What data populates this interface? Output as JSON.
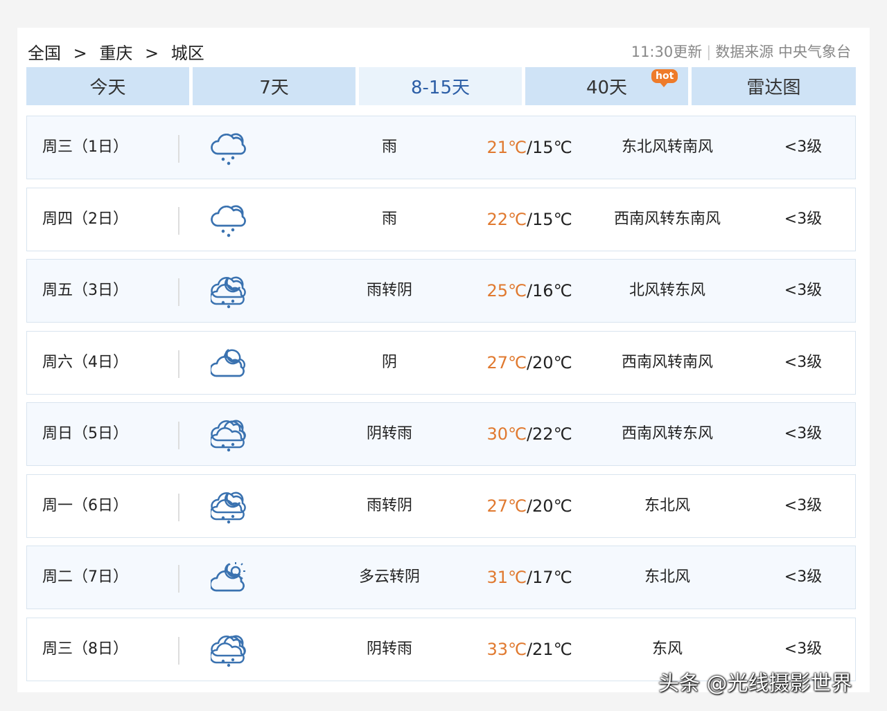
{
  "breadcrumb": {
    "items": [
      "全国",
      "重庆",
      "城区"
    ],
    "separator": ">"
  },
  "source": {
    "update_time": "11:30更新",
    "label": "数据来源 中央气象台"
  },
  "tabs": [
    {
      "label": "今天"
    },
    {
      "label": "7天"
    },
    {
      "label": "8-15天",
      "active": true
    },
    {
      "label": "40天",
      "badge": "hot"
    },
    {
      "label": "雷达图"
    }
  ],
  "colors": {
    "high_temp": "#e0792f",
    "tab_bg": "#cfe3f6",
    "active_tab_text": "#2c5ea6",
    "icon": "#3a72b0"
  },
  "forecast": [
    {
      "day": "周三（1日）",
      "icon_day": "rain-icon",
      "icon_night": "rain-icon",
      "desc": "雨",
      "high": "21℃",
      "low": "/15℃",
      "wind": "东北风转南风",
      "level": "<3级"
    },
    {
      "day": "周四（2日）",
      "icon_day": "rain-icon",
      "icon_night": "rain-icon",
      "desc": "雨",
      "high": "22℃",
      "low": "/15℃",
      "wind": "西南风转东南风",
      "level": "<3级"
    },
    {
      "day": "周五（3日）",
      "icon_day": "rain-icon",
      "icon_night": "cloudy-night-icon",
      "desc": "雨转阴",
      "high": "25℃",
      "low": "/16℃",
      "wind": "北风转东风",
      "level": "<3级"
    },
    {
      "day": "周六（4日）",
      "icon_day": "overcast-icon",
      "icon_night": "cloudy-night-icon",
      "desc": "阴",
      "high": "27℃",
      "low": "/20℃",
      "wind": "西南风转南风",
      "level": "<3级"
    },
    {
      "day": "周日（5日）",
      "icon_day": "overcast-icon",
      "icon_night": "rain-icon",
      "desc": "阴转雨",
      "high": "30℃",
      "low": "/22℃",
      "wind": "西南风转东风",
      "level": "<3级"
    },
    {
      "day": "周一（6日）",
      "icon_day": "rain-icon",
      "icon_night": "cloudy-night-icon",
      "desc": "雨转阴",
      "high": "27℃",
      "low": "/20℃",
      "wind": "东北风",
      "level": "<3级"
    },
    {
      "day": "周二（7日）",
      "icon_day": "partly-cloudy-icon",
      "icon_night": "cloudy-night-icon",
      "desc": "多云转阴",
      "high": "31℃",
      "low": "/17℃",
      "wind": "东北风",
      "level": "<3级"
    },
    {
      "day": "周三（8日）",
      "icon_day": "overcast-icon",
      "icon_night": "rain-icon",
      "desc": "阴转雨",
      "high": "33℃",
      "low": "/21℃",
      "wind": "东风",
      "level": "<3级"
    }
  ],
  "watermark": "头条 @光线摄影世界"
}
